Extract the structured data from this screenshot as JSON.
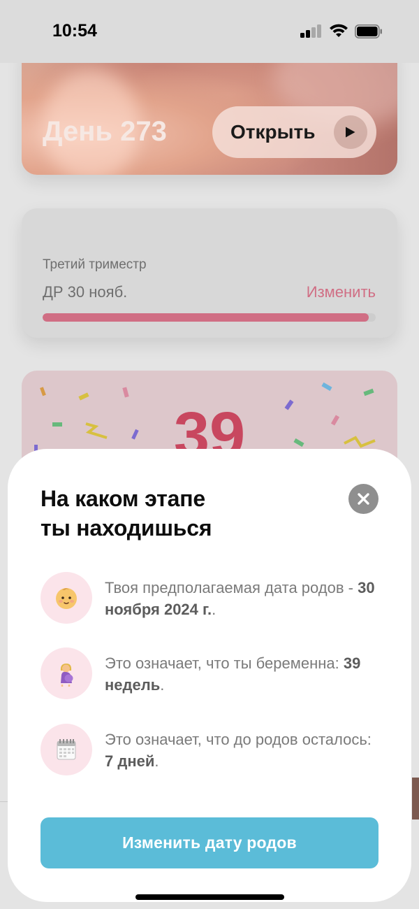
{
  "status_bar": {
    "time": "10:54"
  },
  "background": {
    "hero": {
      "day_label": "День 273",
      "open_label": "Открыть"
    },
    "trimester_card": {
      "trimester_label": "Третий триместр",
      "due_date_short": "ДР 30 нояб.",
      "change_label": "Изменить",
      "progress_percent": 98
    },
    "week_card": {
      "week_number": "39"
    }
  },
  "sheet": {
    "title_line1": "На каком этапе",
    "title_line2": "ты находишься",
    "rows": [
      {
        "icon": "baby-face-icon",
        "text": "Твоя предполагаемая дата родов - ",
        "value": "30 ноября 2024 г.",
        "suffix": "."
      },
      {
        "icon": "pregnant-woman-icon",
        "text": "Это означает, что ты беременна: ",
        "value": "39 недель",
        "suffix": "."
      },
      {
        "icon": "calendar-icon",
        "text": "Это означает, что до родов осталось: ",
        "value": "7 дней",
        "suffix": "."
      }
    ],
    "change_due_date_button": "Изменить дату родов"
  },
  "colors": {
    "accent_pink": "#d06e84",
    "primary_button": "#5bbcd8",
    "week_number": "#c8475f",
    "icon_circle": "#fbe4ea"
  }
}
